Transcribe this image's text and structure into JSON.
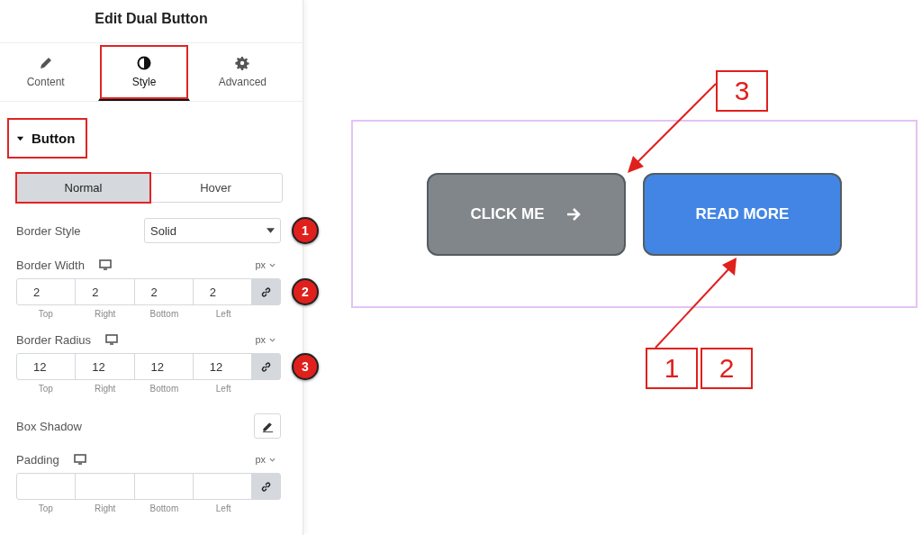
{
  "panel": {
    "title": "Edit Dual Button",
    "tabs": [
      {
        "label": "Content",
        "selected": false,
        "highlighted": false
      },
      {
        "label": "Style",
        "selected": true,
        "highlighted": true
      },
      {
        "label": "Advanced",
        "selected": false,
        "highlighted": false
      }
    ],
    "section": {
      "title": "Button",
      "expanded": true,
      "highlighted": true
    },
    "state_tabs": [
      {
        "label": "Normal",
        "selected": true,
        "highlighted": true
      },
      {
        "label": "Hover",
        "selected": false,
        "highlighted": false
      }
    ],
    "controls": [
      {
        "kind": "select",
        "label": "Border Style",
        "value": "Solid",
        "badge": "1"
      },
      {
        "kind": "dimensions",
        "label": "Border Width",
        "unit": "px",
        "values": [
          "2",
          "2",
          "2",
          "2"
        ],
        "sublabels": [
          "Top",
          "Right",
          "Bottom",
          "Left"
        ],
        "linked": true,
        "badge": "2"
      },
      {
        "kind": "dimensions",
        "label": "Border Radius",
        "unit": "px",
        "values": [
          "12",
          "12",
          "12",
          "12"
        ],
        "sublabels": [
          "Top",
          "Right",
          "Bottom",
          "Left"
        ],
        "linked": true,
        "badge": "3"
      },
      {
        "kind": "edit",
        "label": "Box Shadow"
      },
      {
        "kind": "dimensions",
        "label": "Padding",
        "unit": "px",
        "sublabels": [
          "Top",
          "Right",
          "Bottom",
          "Left"
        ],
        "linked": true
      }
    ]
  },
  "preview": {
    "buttons": [
      {
        "label": "CLICK ME",
        "color": "#808689",
        "arrow": true
      },
      {
        "label": "READ MORE",
        "color": "#4285e4",
        "arrow": false
      }
    ],
    "callouts_top": [
      {
        "label": "3"
      }
    ],
    "callouts_bottom": [
      {
        "label": "1"
      },
      {
        "label": "2"
      }
    ]
  }
}
